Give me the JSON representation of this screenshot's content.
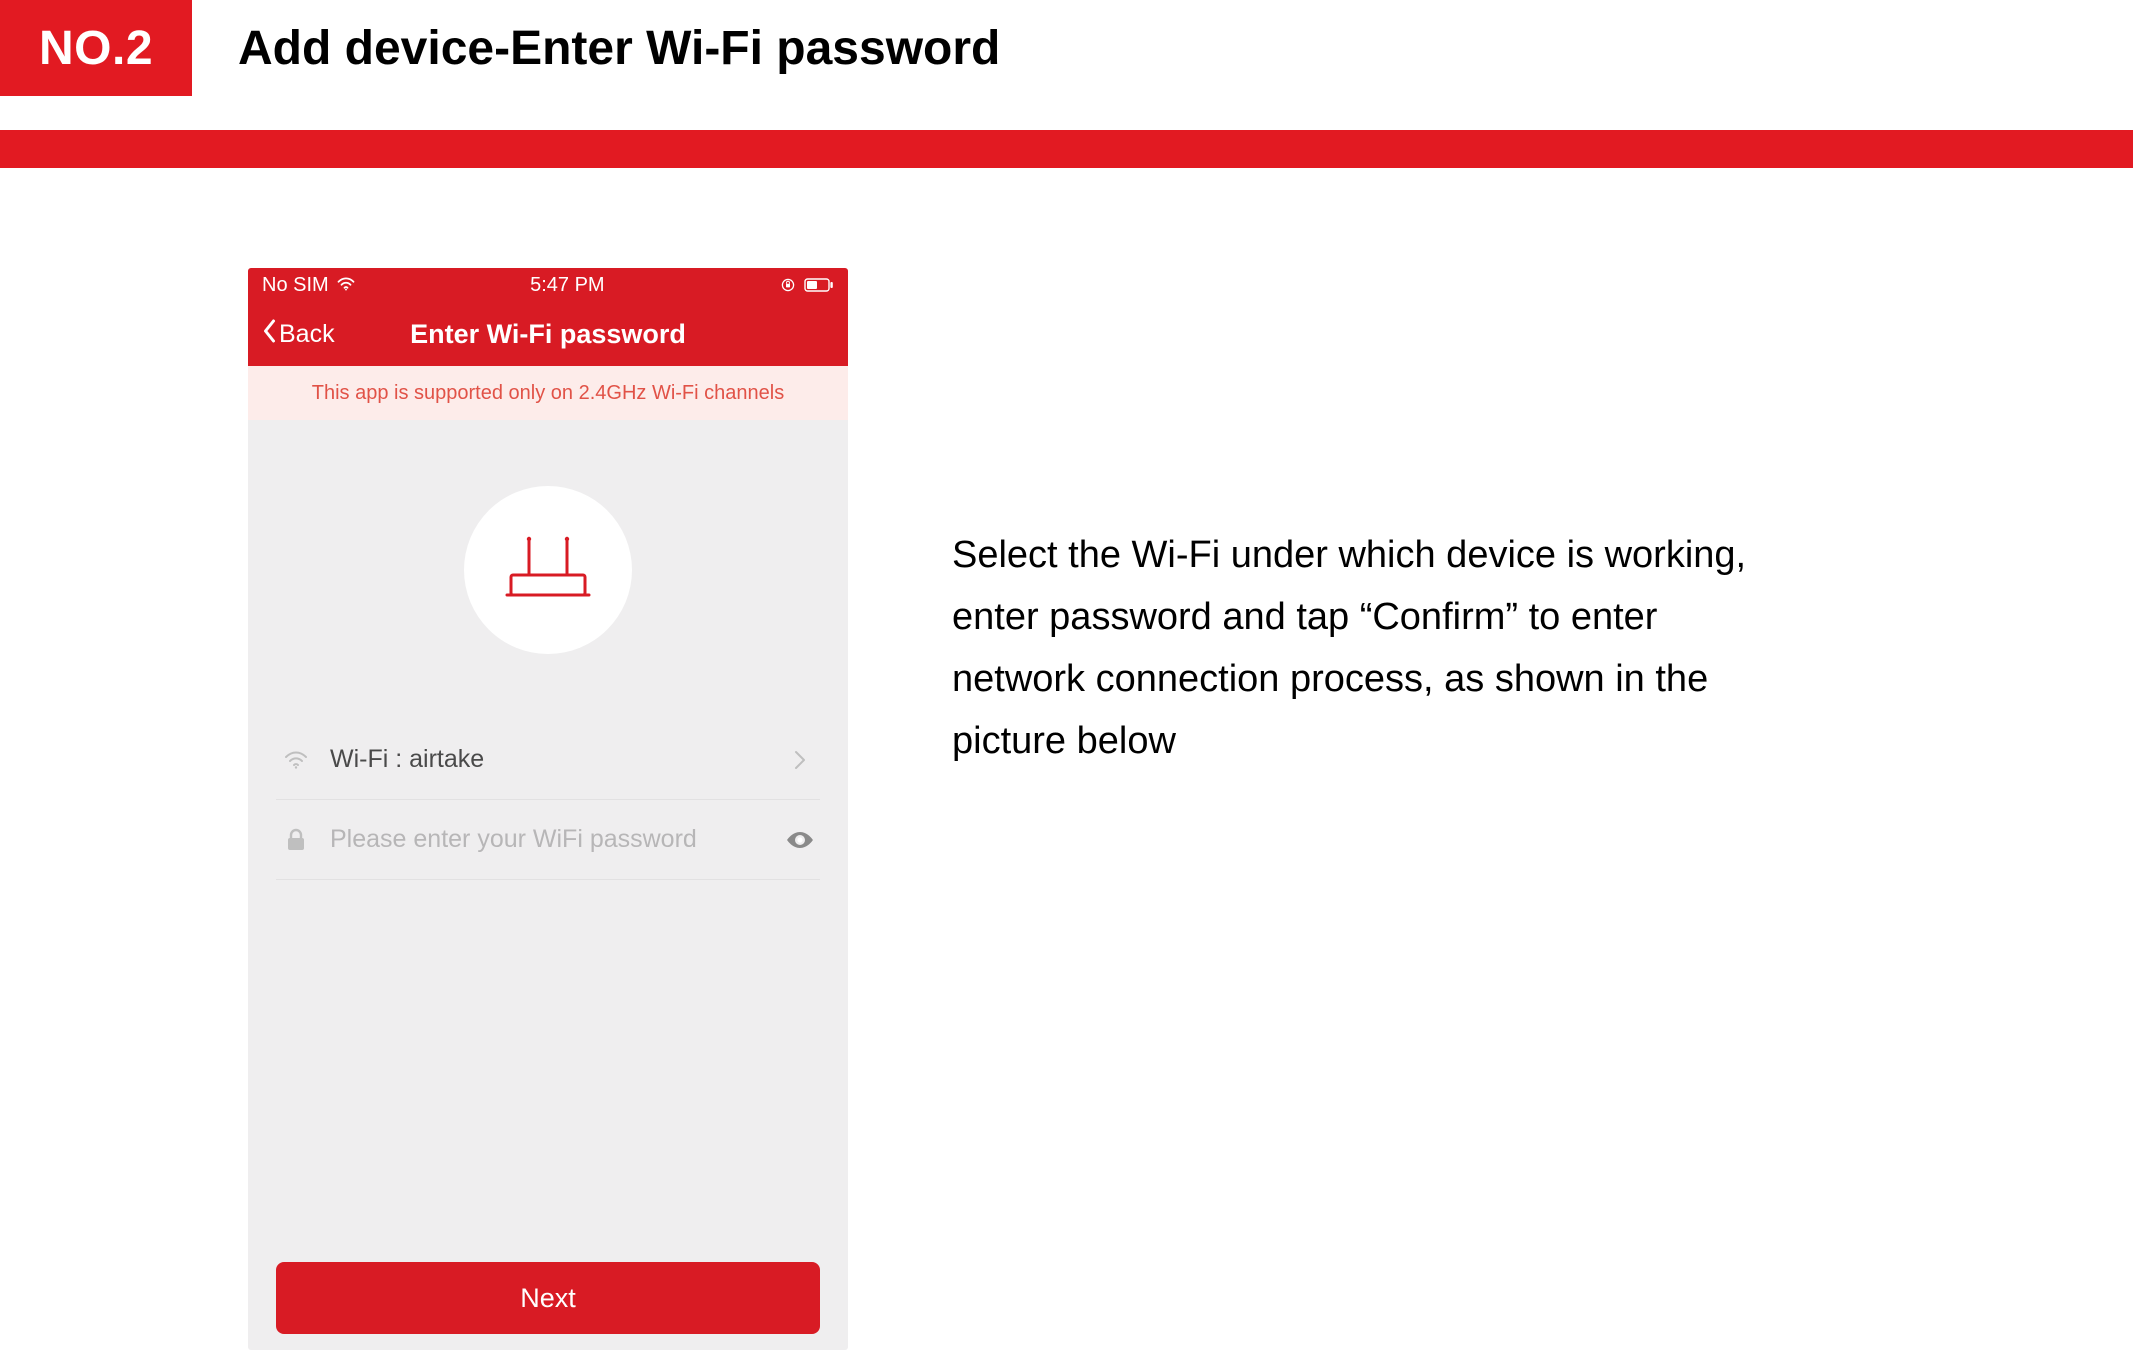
{
  "page": {
    "step_label": "NO.2",
    "step_title": "Add device-Enter Wi-Fi password",
    "instruction_text": "Select the Wi-Fi under which device is working, enter password and tap “Confirm” to enter network connection process, as shown in the picture below"
  },
  "phone": {
    "status": {
      "carrier": "No SIM",
      "time": "5:47 PM"
    },
    "nav": {
      "back_label": "Back",
      "title": "Enter Wi-Fi password"
    },
    "banner": "This app is supported only on 2.4GHz Wi-Fi channels",
    "wifi_row": {
      "label": "Wi-Fi : airtake"
    },
    "password_row": {
      "placeholder": "Please enter your WiFi password",
      "value": ""
    },
    "next_label": "Next"
  },
  "colors": {
    "brand_red": "#e21a22"
  }
}
